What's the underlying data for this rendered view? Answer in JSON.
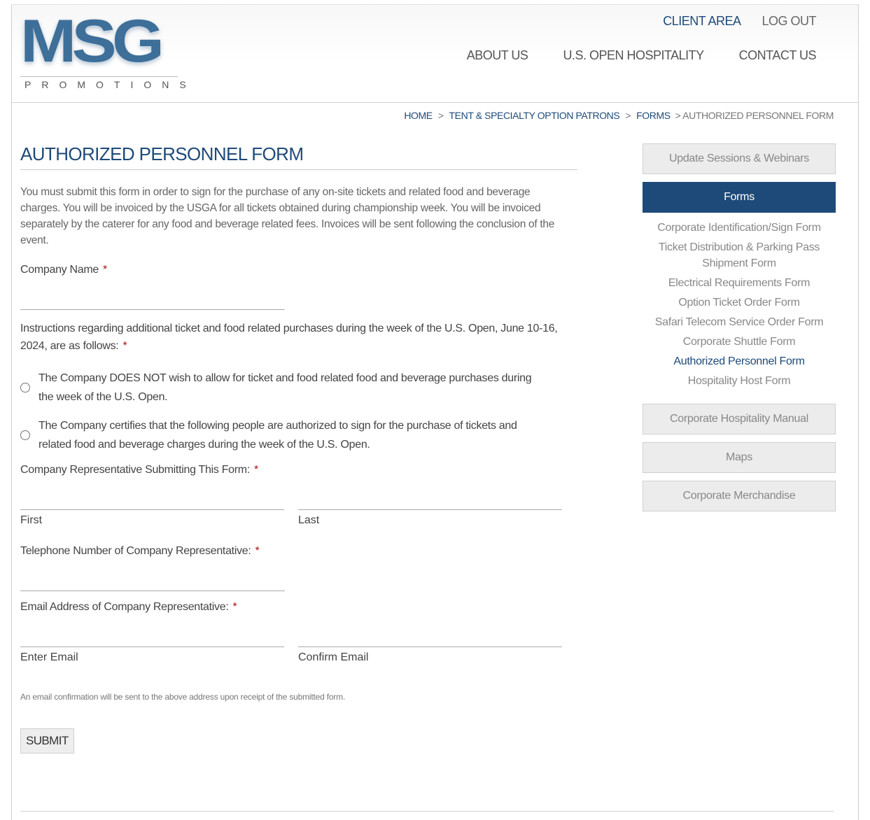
{
  "header": {
    "logo_text": "MSG",
    "logo_sub": "PROMOTIONS",
    "top_links": {
      "client_area": "CLIENT AREA",
      "log_out": "LOG OUT"
    },
    "nav": {
      "about_us": "ABOUT US",
      "us_open_hospitality": "U.S. OPEN HOSPITALITY",
      "contact_us": "CONTACT US"
    }
  },
  "breadcrumb": {
    "home": "HOME",
    "sep": ">",
    "tent": "TENT & SPECIALTY OPTION PATRONS",
    "forms": "FORMS",
    "current": "> AUTHORIZED PERSONNEL FORM"
  },
  "form": {
    "title": "AUTHORIZED PERSONNEL FORM",
    "intro": "You must submit this form in order to sign for the purchase of any on-site tickets and related food and beverage charges. You will be invoiced by the USGA for all tickets obtained during championship week. You will be invoiced separately by the caterer for any food and beverage related fees. Invoices will be sent following the conclusion of the event.",
    "required_mark": "*",
    "company_name_label": "Company Name",
    "company_name_value": "",
    "instructions_label": "Instructions regarding additional ticket and food related purchases during the week of the U.S. Open, June 10-16, 2024, are as follows:",
    "radio_options": [
      {
        "text": "The Company DOES NOT wish to allow for ticket and food related food and beverage purchases during the week of the U.S. Open.",
        "checked": false
      },
      {
        "text": "The Company certifies that the following people are authorized to sign for the purchase of tickets and related food and beverage charges during the week of the U.S. Open.",
        "checked": false
      }
    ],
    "rep_label": "Company Representative Submitting This Form:",
    "first_label": "First",
    "last_label": "Last",
    "phone_label": "Telephone Number of Company Representative:",
    "email_label": "Email Address of Company Representative:",
    "enter_email_label": "Enter Email",
    "confirm_email_label": "Confirm Email",
    "email_note": "An email confirmation will be sent to the above address upon receipt of the submitted form.",
    "submit_label": "SUBMIT"
  },
  "sidebar": {
    "update_sessions": "Update Sessions & Webinars",
    "forms": "Forms",
    "form_links": [
      "Corporate Identification/Sign Form",
      "Ticket Distribution & Parking Pass Shipment Form",
      "Electrical Requirements Form",
      "Option Ticket Order Form",
      "Safari Telecom Service Order Form",
      "Corporate Shuttle Form",
      "Authorized Personnel Form",
      "Hospitality Host Form"
    ],
    "hospitality_manual": "Corporate Hospitality Manual",
    "maps": "Maps",
    "merchandise": "Corporate Merchandise"
  },
  "colors": {
    "brand_blue": "#1e4a7a",
    "required_red": "#aa1111",
    "sidebar_gray": "#ececec"
  }
}
